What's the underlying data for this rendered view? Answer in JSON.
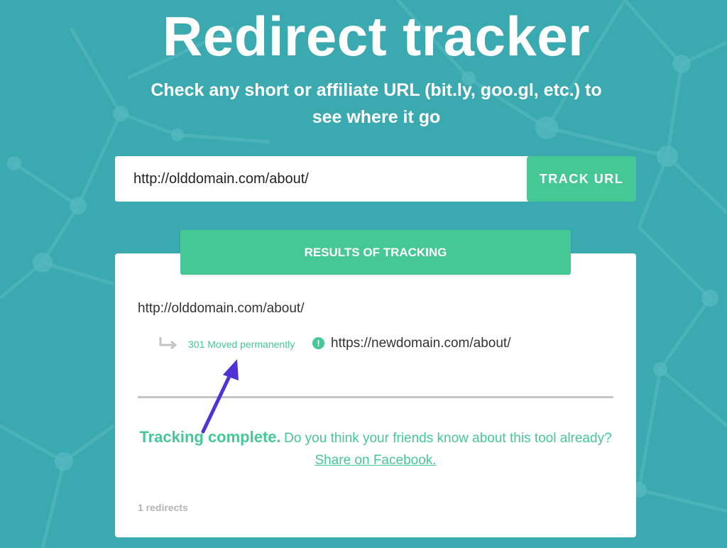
{
  "header": {
    "title": "Redirect tracker",
    "subtitle": "Check any short or affiliate URL (bit.ly, goo.gl, etc.) to see where it go"
  },
  "form": {
    "url_value": "http://olddomain.com/about/",
    "track_label": "TRACK URL"
  },
  "results": {
    "header_label": "RESULTS OF TRACKING",
    "source_url": "http://olddomain.com/about/",
    "redirects": [
      {
        "status": "301 Moved permanently",
        "target_url": "https://newdomain.com/about/"
      }
    ],
    "complete_label": "Tracking complete.",
    "complete_question": "Do you think your friends know about this tool already?",
    "share_label": "Share on Facebook.",
    "redirect_count": "1 redirects"
  },
  "colors": {
    "background": "#3aa9b0",
    "accent": "#45c895",
    "annotation": "#5033d8"
  },
  "icons": {
    "redirect": "redirect-arrow-icon",
    "warning": "exclaim-icon",
    "annotation": "annotation-arrow-icon"
  }
}
